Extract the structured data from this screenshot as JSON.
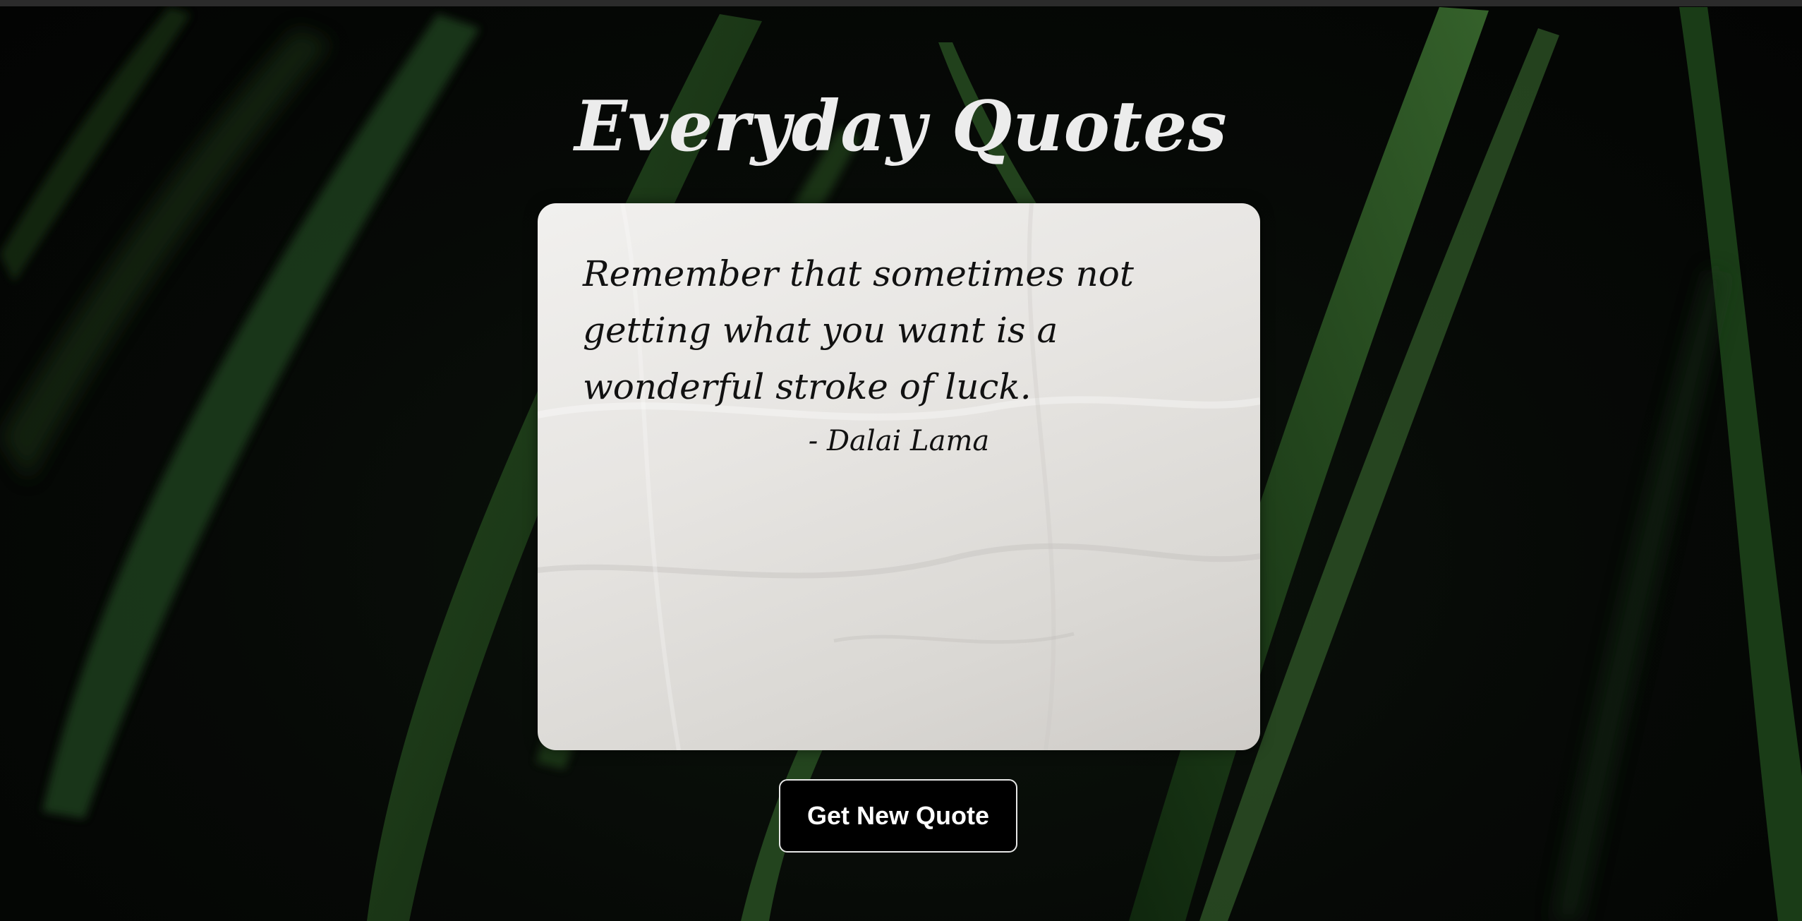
{
  "header": {
    "title": "Everyday Quotes"
  },
  "quote": {
    "text": "Remember that sometimes not getting what you want is a wonderful stroke of luck.",
    "author": "- Dalai Lama"
  },
  "actions": {
    "new_quote_label": "Get New Quote"
  },
  "colors": {
    "background": "#050705",
    "leaf": "#1f4a1c",
    "card": "#e8e6e3",
    "title": "#ececec",
    "button_bg": "#000000",
    "button_border": "#e6e6e6"
  }
}
